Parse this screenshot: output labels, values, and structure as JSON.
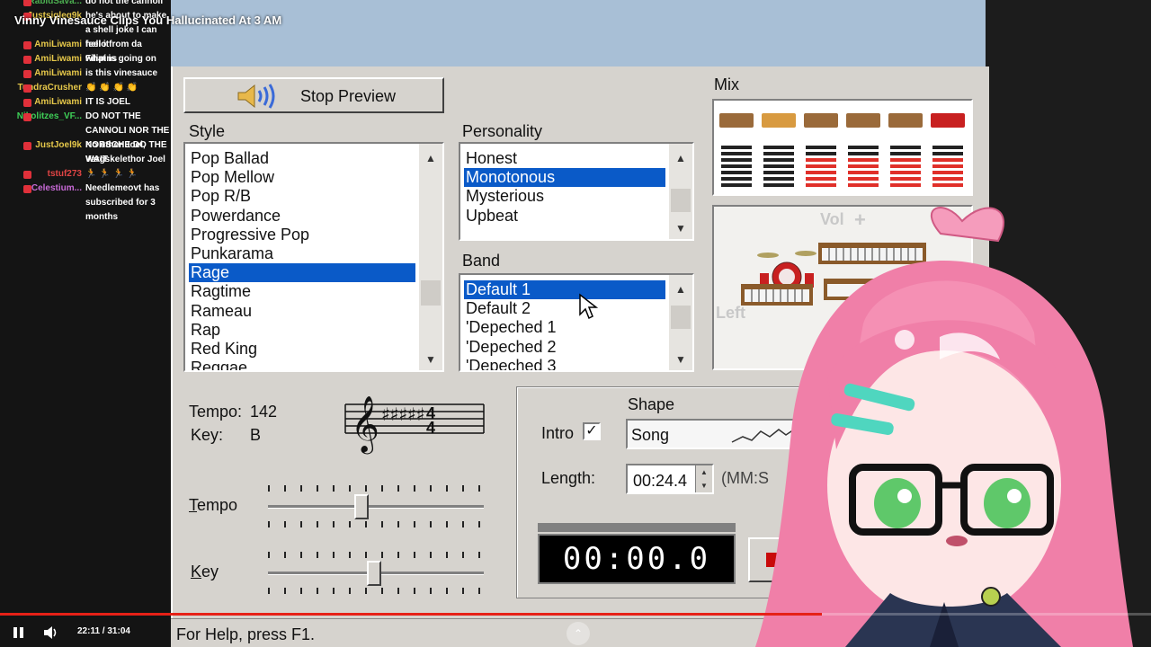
{
  "video": {
    "title": "Vinny Vinesauce Clips You Hallucinated At 3 AM",
    "time": "22:11 / 31:04",
    "progress_fraction": 0.714
  },
  "chat": [
    {
      "user": "RabidSava...",
      "msg": "do not the cannoli",
      "user_color": "#4caf50"
    },
    {
      "user": "Justsigleq9k",
      "msg": "he's about to make a shell joke I can feel it",
      "user_color": "#e6c84a"
    },
    {
      "user": "AmiLiwami",
      "msg": "hello from da Filipins",
      "user_color": "#e6c84a"
    },
    {
      "user": "AmiLiwami",
      "msg": "what is going on",
      "user_color": "#e6c84a"
    },
    {
      "user": "AmiLiwami",
      "msg": "is this vinesauce",
      "user_color": "#e6c84a"
    },
    {
      "user": "TundraCrusher",
      "msg": "👏 👏 👏 👏",
      "user_color": "#e6c84a"
    },
    {
      "user": "AmiLiwami",
      "msg": "IT IS JOEL",
      "user_color": "#e6c84a"
    },
    {
      "user": "Nikolitzes_VF...",
      "msg": "DO NOT THE CANNOLI NOR THE KORSCHE DO THE WAIT",
      "user_color": "#3ecf57"
    },
    {
      "user": "JustJoel9k",
      "msg": "No other Joel, Vargskelethor Joel",
      "user_color": "#e6c84a"
    },
    {
      "user": "tstuf273",
      "msg": "🏃 🏃 🏃 🏃",
      "user_color": "#e04444"
    },
    {
      "user": "Celestium...",
      "msg": "Needlemeovt has subscribed for 3 months",
      "user_color": "#c86ad6"
    }
  ],
  "app": {
    "stop_preview_label": "Stop Preview",
    "style_label": "Style",
    "style_items": [
      "Pop Ballad",
      "Pop Mellow",
      "Pop R/B",
      "Powerdance",
      "Progressive Pop",
      "Punkarama",
      "Rage",
      "Ragtime",
      "Rameau",
      "Rap",
      "Red King",
      "Reggae"
    ],
    "style_selected": "Rage",
    "personality_label": "Personality",
    "personality_items": [
      "Honest",
      "Monotonous",
      "Mysterious",
      "Upbeat"
    ],
    "personality_selected": "Monotonous",
    "band_label": "Band",
    "band_items": [
      "Default 1",
      "Default 2",
      "'Depeched 1",
      "'Depeched 2",
      "'Depeched 3"
    ],
    "band_selected": "Default 1",
    "mix_label": "Mix",
    "vol_label": "Vol",
    "left_label": "Left",
    "tempo_text_label": "Tempo:",
    "tempo_value": "142",
    "key_text_label": "Key:",
    "key_value": "B",
    "tempo_slider_label": "Tempo",
    "key_slider_label": "Key",
    "tempo_slider_pos": 0.43,
    "key_slider_pos": 0.49,
    "shape_label": "Shape",
    "intro_label": "Intro",
    "intro_checked": true,
    "shape_value": "Song",
    "length_label": "Length:",
    "length_value": "00:24.4",
    "length_unit": "(MM:S",
    "timer": "00:00.0",
    "status": "For Help, press F1."
  }
}
